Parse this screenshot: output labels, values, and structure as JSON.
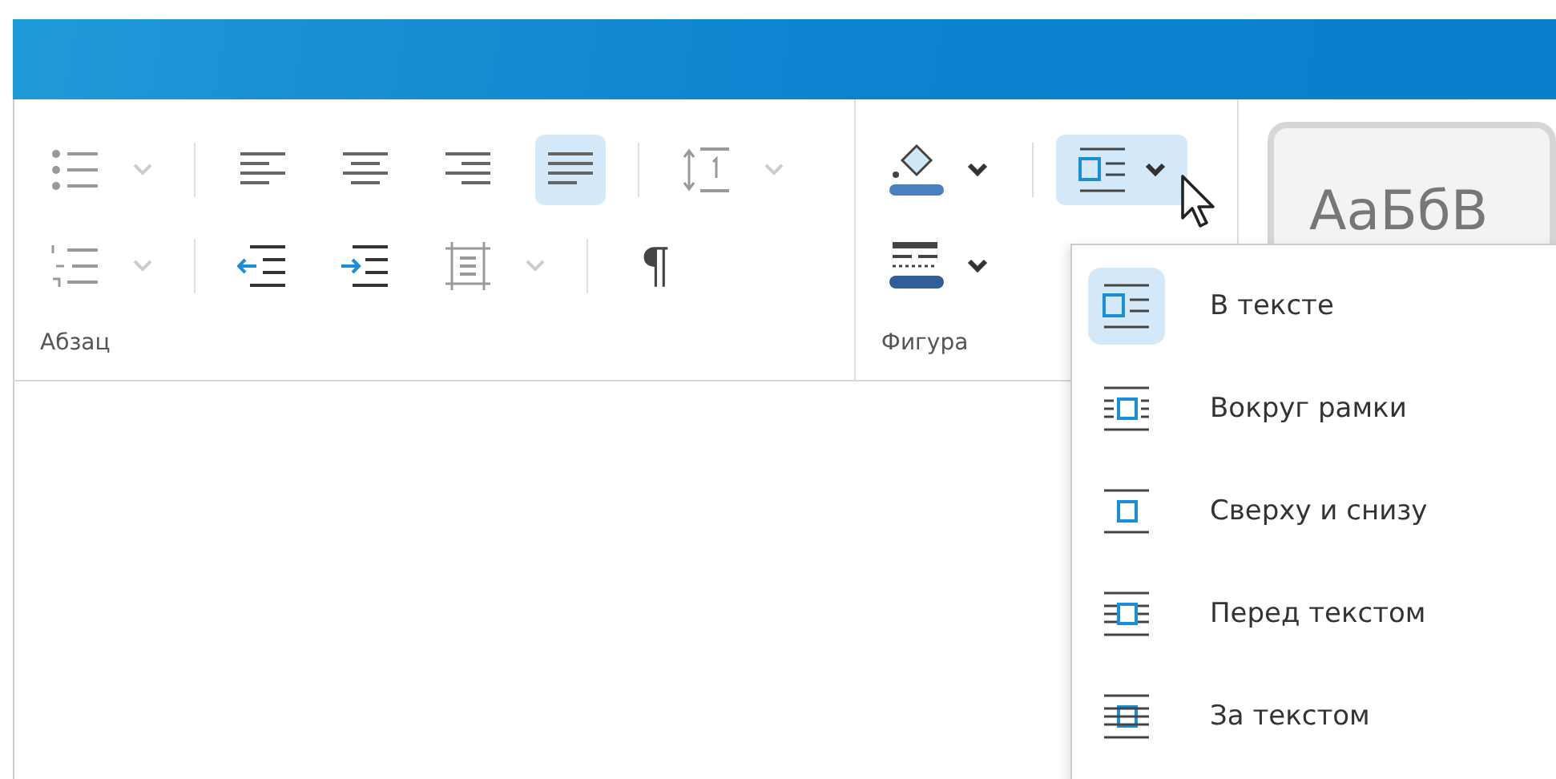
{
  "paragraph": {
    "label": "Абзац",
    "rows": [
      [
        {
          "kind": "bullets",
          "dropdown": true,
          "disabled": true
        },
        {
          "kind": "sep"
        },
        {
          "kind": "align-left",
          "selected": false
        },
        {
          "kind": "align-center",
          "selected": false
        },
        {
          "kind": "align-right",
          "selected": false
        },
        {
          "kind": "justify",
          "selected": true
        },
        {
          "kind": "sep"
        },
        {
          "kind": "spacing",
          "dropdown": true,
          "disabled": true
        }
      ],
      [
        {
          "kind": "numbering",
          "dropdown": true,
          "disabled": true
        },
        {
          "kind": "sep"
        },
        {
          "kind": "outdent"
        },
        {
          "kind": "indent"
        },
        {
          "kind": "borders",
          "dropdown": true,
          "disabled": true
        },
        {
          "kind": "sep"
        },
        {
          "kind": "pilcrow",
          "text": "¶"
        }
      ]
    ]
  },
  "shape": {
    "label": "Фигура",
    "fill": {
      "expanded": false
    },
    "outline": {
      "expanded": false
    },
    "wrap": {
      "expanded": true
    }
  },
  "styles": {
    "preview": "АаБбВ"
  },
  "wrap_menu": [
    {
      "kind": "inline",
      "label": "В тексте",
      "selected": true
    },
    {
      "kind": "square",
      "label": "Вокруг рамки",
      "selected": false
    },
    {
      "kind": "topbottom",
      "label": "Сверху и снизу",
      "selected": false
    },
    {
      "kind": "front",
      "label": "Перед текстом",
      "selected": false
    },
    {
      "kind": "behind",
      "label": "За текстом",
      "selected": false
    }
  ]
}
